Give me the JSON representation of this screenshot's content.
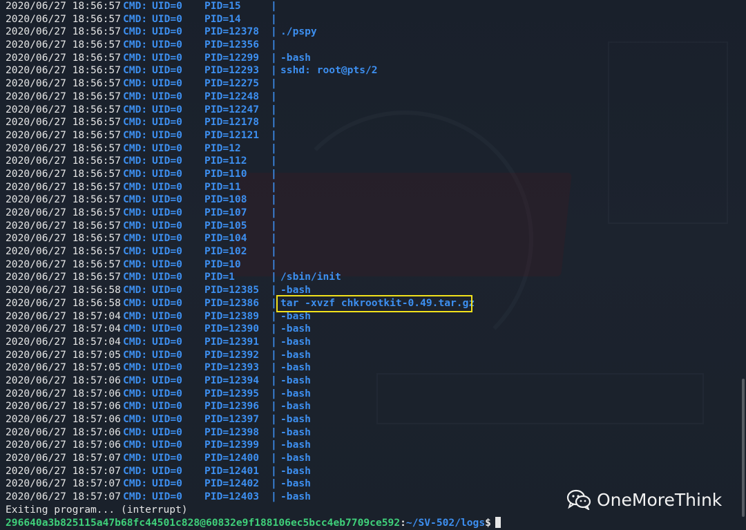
{
  "terminal": {
    "log_rows": [
      {
        "ts": "2020/06/27 18:56:57",
        "cmd": "CMD:",
        "uid": "UID=0",
        "pid": "PID=15",
        "proc": ""
      },
      {
        "ts": "2020/06/27 18:56:57",
        "cmd": "CMD:",
        "uid": "UID=0",
        "pid": "PID=14",
        "proc": ""
      },
      {
        "ts": "2020/06/27 18:56:57",
        "cmd": "CMD:",
        "uid": "UID=0",
        "pid": "PID=12378",
        "proc": "./pspy"
      },
      {
        "ts": "2020/06/27 18:56:57",
        "cmd": "CMD:",
        "uid": "UID=0",
        "pid": "PID=12356",
        "proc": ""
      },
      {
        "ts": "2020/06/27 18:56:57",
        "cmd": "CMD:",
        "uid": "UID=0",
        "pid": "PID=12299",
        "proc": "-bash"
      },
      {
        "ts": "2020/06/27 18:56:57",
        "cmd": "CMD:",
        "uid": "UID=0",
        "pid": "PID=12293",
        "proc": "sshd: root@pts/2"
      },
      {
        "ts": "2020/06/27 18:56:57",
        "cmd": "CMD:",
        "uid": "UID=0",
        "pid": "PID=12275",
        "proc": ""
      },
      {
        "ts": "2020/06/27 18:56:57",
        "cmd": "CMD:",
        "uid": "UID=0",
        "pid": "PID=12248",
        "proc": ""
      },
      {
        "ts": "2020/06/27 18:56:57",
        "cmd": "CMD:",
        "uid": "UID=0",
        "pid": "PID=12247",
        "proc": ""
      },
      {
        "ts": "2020/06/27 18:56:57",
        "cmd": "CMD:",
        "uid": "UID=0",
        "pid": "PID=12178",
        "proc": ""
      },
      {
        "ts": "2020/06/27 18:56:57",
        "cmd": "CMD:",
        "uid": "UID=0",
        "pid": "PID=12121",
        "proc": ""
      },
      {
        "ts": "2020/06/27 18:56:57",
        "cmd": "CMD:",
        "uid": "UID=0",
        "pid": "PID=12",
        "proc": ""
      },
      {
        "ts": "2020/06/27 18:56:57",
        "cmd": "CMD:",
        "uid": "UID=0",
        "pid": "PID=112",
        "proc": ""
      },
      {
        "ts": "2020/06/27 18:56:57",
        "cmd": "CMD:",
        "uid": "UID=0",
        "pid": "PID=110",
        "proc": ""
      },
      {
        "ts": "2020/06/27 18:56:57",
        "cmd": "CMD:",
        "uid": "UID=0",
        "pid": "PID=11",
        "proc": ""
      },
      {
        "ts": "2020/06/27 18:56:57",
        "cmd": "CMD:",
        "uid": "UID=0",
        "pid": "PID=108",
        "proc": ""
      },
      {
        "ts": "2020/06/27 18:56:57",
        "cmd": "CMD:",
        "uid": "UID=0",
        "pid": "PID=107",
        "proc": ""
      },
      {
        "ts": "2020/06/27 18:56:57",
        "cmd": "CMD:",
        "uid": "UID=0",
        "pid": "PID=105",
        "proc": ""
      },
      {
        "ts": "2020/06/27 18:56:57",
        "cmd": "CMD:",
        "uid": "UID=0",
        "pid": "PID=104",
        "proc": ""
      },
      {
        "ts": "2020/06/27 18:56:57",
        "cmd": "CMD:",
        "uid": "UID=0",
        "pid": "PID=102",
        "proc": ""
      },
      {
        "ts": "2020/06/27 18:56:57",
        "cmd": "CMD:",
        "uid": "UID=0",
        "pid": "PID=10",
        "proc": ""
      },
      {
        "ts": "2020/06/27 18:56:57",
        "cmd": "CMD:",
        "uid": "UID=0",
        "pid": "PID=1",
        "proc": "/sbin/init"
      },
      {
        "ts": "2020/06/27 18:56:58",
        "cmd": "CMD:",
        "uid": "UID=0",
        "pid": "PID=12385",
        "proc": "-bash"
      },
      {
        "ts": "2020/06/27 18:56:58",
        "cmd": "CMD:",
        "uid": "UID=0",
        "pid": "PID=12386",
        "proc": "tar -xvzf chkrootkit-0.49.tar.gz"
      },
      {
        "ts": "2020/06/27 18:57:04",
        "cmd": "CMD:",
        "uid": "UID=0",
        "pid": "PID=12389",
        "proc": "-bash"
      },
      {
        "ts": "2020/06/27 18:57:04",
        "cmd": "CMD:",
        "uid": "UID=0",
        "pid": "PID=12390",
        "proc": "-bash"
      },
      {
        "ts": "2020/06/27 18:57:04",
        "cmd": "CMD:",
        "uid": "UID=0",
        "pid": "PID=12391",
        "proc": "-bash"
      },
      {
        "ts": "2020/06/27 18:57:05",
        "cmd": "CMD:",
        "uid": "UID=0",
        "pid": "PID=12392",
        "proc": "-bash"
      },
      {
        "ts": "2020/06/27 18:57:05",
        "cmd": "CMD:",
        "uid": "UID=0",
        "pid": "PID=12393",
        "proc": "-bash"
      },
      {
        "ts": "2020/06/27 18:57:06",
        "cmd": "CMD:",
        "uid": "UID=0",
        "pid": "PID=12394",
        "proc": "-bash"
      },
      {
        "ts": "2020/06/27 18:57:06",
        "cmd": "CMD:",
        "uid": "UID=0",
        "pid": "PID=12395",
        "proc": "-bash"
      },
      {
        "ts": "2020/06/27 18:57:06",
        "cmd": "CMD:",
        "uid": "UID=0",
        "pid": "PID=12396",
        "proc": "-bash"
      },
      {
        "ts": "2020/06/27 18:57:06",
        "cmd": "CMD:",
        "uid": "UID=0",
        "pid": "PID=12397",
        "proc": "-bash"
      },
      {
        "ts": "2020/06/27 18:57:06",
        "cmd": "CMD:",
        "uid": "UID=0",
        "pid": "PID=12398",
        "proc": "-bash"
      },
      {
        "ts": "2020/06/27 18:57:06",
        "cmd": "CMD:",
        "uid": "UID=0",
        "pid": "PID=12399",
        "proc": "-bash"
      },
      {
        "ts": "2020/06/27 18:57:07",
        "cmd": "CMD:",
        "uid": "UID=0",
        "pid": "PID=12400",
        "proc": "-bash"
      },
      {
        "ts": "2020/06/27 18:57:07",
        "cmd": "CMD:",
        "uid": "UID=0",
        "pid": "PID=12401",
        "proc": "-bash"
      },
      {
        "ts": "2020/06/27 18:57:07",
        "cmd": "CMD:",
        "uid": "UID=0",
        "pid": "PID=12402",
        "proc": "-bash"
      },
      {
        "ts": "2020/06/27 18:57:07",
        "cmd": "CMD:",
        "uid": "UID=0",
        "pid": "PID=12403",
        "proc": "-bash"
      }
    ],
    "separator": "|",
    "exit_message": "Exiting program... (interrupt)",
    "prompt": {
      "user_host": "296640a3b825115a47b68fc44501c828@60832e9f188106ec5bcc4eb7709ce592",
      "sep": ":",
      "path": "~/SV-502/logs",
      "dollar": "$"
    },
    "highlighted_pid": "PID=12386"
  },
  "watermark": {
    "text": "OneMoreThink",
    "icon": "wechat-icon"
  },
  "colors": {
    "background": "#1b212c",
    "log_blue": "#3d8ff0",
    "prompt_green": "#3fd07a",
    "highlight_yellow": "#f3e21b",
    "text_white": "#e6e6e6"
  }
}
